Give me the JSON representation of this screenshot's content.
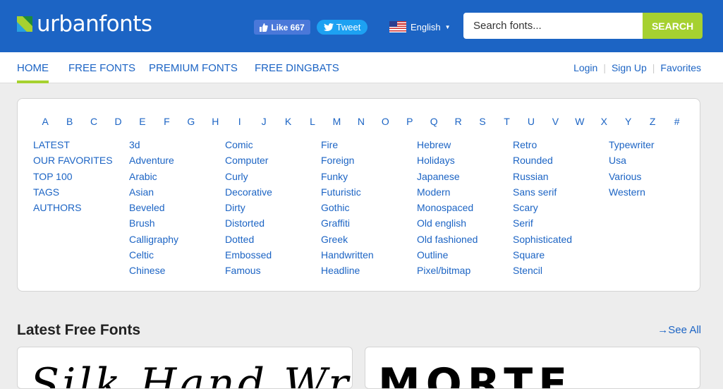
{
  "header": {
    "logo_text": "urbanfonts",
    "fb_like_label": "Like 667",
    "tweet_label": "Tweet",
    "language": "English",
    "search_placeholder": "Search fonts...",
    "search_button": "SEARCH"
  },
  "nav": {
    "items": [
      "HOME",
      "FREE FONTS",
      "PREMIUM FONTS",
      "FREE DINGBATS"
    ],
    "active": "HOME",
    "login": "Login",
    "signup": "Sign Up",
    "favorites": "Favorites"
  },
  "alphabet": [
    "A",
    "B",
    "C",
    "D",
    "E",
    "F",
    "G",
    "H",
    "I",
    "J",
    "K",
    "L",
    "M",
    "N",
    "O",
    "P",
    "Q",
    "R",
    "S",
    "T",
    "U",
    "V",
    "W",
    "X",
    "Y",
    "Z",
    "#"
  ],
  "categories": [
    [
      "LATEST",
      "OUR FAVORITES",
      "TOP 100",
      "TAGS",
      "AUTHORS"
    ],
    [
      "3d",
      "Adventure",
      "Arabic",
      "Asian",
      "Beveled",
      "Brush",
      "Calligraphy",
      "Celtic",
      "Chinese"
    ],
    [
      "Comic",
      "Computer",
      "Curly",
      "Decorative",
      "Dirty",
      "Distorted",
      "Dotted",
      "Embossed",
      "Famous"
    ],
    [
      "Fire",
      "Foreign",
      "Funky",
      "Futuristic",
      "Gothic",
      "Graffiti",
      "Greek",
      "Handwritten",
      "Headline"
    ],
    [
      "Hebrew",
      "Holidays",
      "Japanese",
      "Modern",
      "Monospaced",
      "Old english",
      "Old fashioned",
      "Outline",
      "Pixel/bitmap"
    ],
    [
      "Retro",
      "Rounded",
      "Russian",
      "Sans serif",
      "Scary",
      "Serif",
      "Sophisticated",
      "Square",
      "Stencil"
    ],
    [
      "Typewriter",
      "Usa",
      "Various",
      "Western"
    ]
  ],
  "latest": {
    "title": "Latest Free Fonts",
    "see_all": "See All",
    "previews": [
      "Silk Hand Written",
      "MORTE"
    ]
  },
  "colors": {
    "brand_blue": "#1c64c4",
    "accent_green": "#a6d130"
  }
}
